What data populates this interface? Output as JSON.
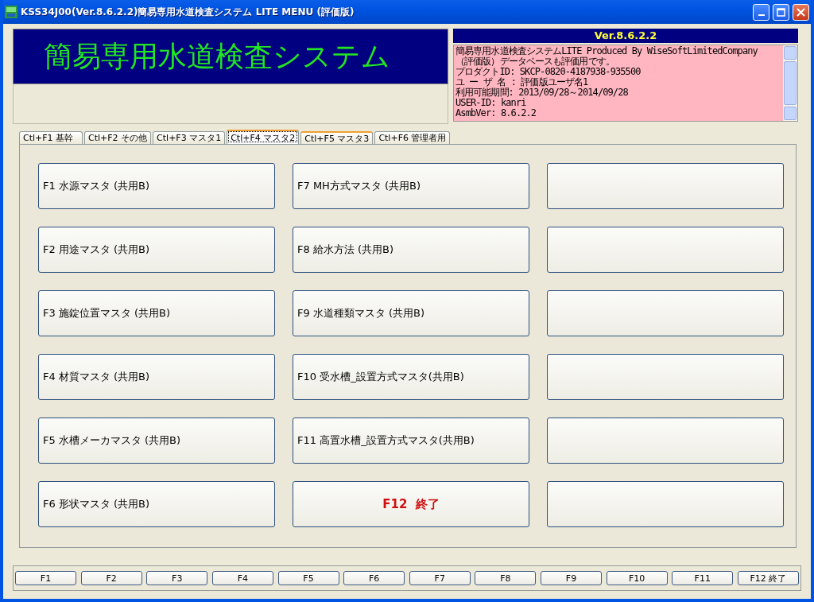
{
  "window": {
    "title": "KSS34J00(Ver.8.6.2.2)簡易専用水道検査システム LITE MENU (評価版)"
  },
  "banner": {
    "title": "簡易専用水道検査システム"
  },
  "info": {
    "version": "Ver.8.6.2.2",
    "lines": [
      "簡易専用水道検査システムLITE Produced By WiseSoftLimitedCompany",
      "（評価版）データベースも評価用です。",
      "プロダクトID: SKCP-0820-4187938-935500",
      "ユ ー ザ 名 : 評価版ユーザ名1",
      "利用可能期間: 2013/09/28～2014/09/28",
      "USER-ID: kanri",
      "AsmbVer: 8.6.2.2"
    ]
  },
  "tabs": [
    {
      "label": "Ctl+F1 基幹",
      "selected": false,
      "hot": false
    },
    {
      "label": "Ctl+F2 その他",
      "selected": false,
      "hot": false
    },
    {
      "label": "Ctl+F3 マスタ1",
      "selected": false,
      "hot": false
    },
    {
      "label": "Ctl+F4 マスタ2",
      "selected": true,
      "hot": true
    },
    {
      "label": "Ctl+F5 マスタ3",
      "selected": false,
      "hot": true
    },
    {
      "label": "Ctl+F6 管理者用",
      "selected": false,
      "hot": false
    }
  ],
  "menu_buttons": [
    {
      "kind": "menu",
      "label": "F1 水源マスタ (共用B)"
    },
    {
      "kind": "menu",
      "label": "F7 MH方式マスタ (共用B)"
    },
    {
      "kind": "blank"
    },
    {
      "kind": "menu",
      "label": "F2 用途マスタ (共用B)"
    },
    {
      "kind": "menu",
      "label": "F8 給水方法 (共用B)"
    },
    {
      "kind": "blank"
    },
    {
      "kind": "menu",
      "label": "F3 施錠位置マスタ (共用B)"
    },
    {
      "kind": "menu",
      "label": "F9 水道種類マスタ (共用B)"
    },
    {
      "kind": "blank"
    },
    {
      "kind": "menu",
      "label": "F4 材質マスタ (共用B)"
    },
    {
      "kind": "menu",
      "label": "F10 受水槽_設置方式マスタ(共用B)"
    },
    {
      "kind": "blank"
    },
    {
      "kind": "menu",
      "label": "F5 水槽メーカマスタ (共用B)"
    },
    {
      "kind": "menu",
      "label": "F11 高置水槽_設置方式マスタ(共用B)"
    },
    {
      "kind": "blank"
    },
    {
      "kind": "menu",
      "label": "F6 形状マスタ (共用B)"
    },
    {
      "kind": "exit",
      "label": "F12  終了"
    },
    {
      "kind": "blank"
    }
  ],
  "function_keys": [
    "F1",
    "F2",
    "F3",
    "F4",
    "F5",
    "F6",
    "F7",
    "F8",
    "F9",
    "F10",
    "F11",
    "F12 終了"
  ]
}
